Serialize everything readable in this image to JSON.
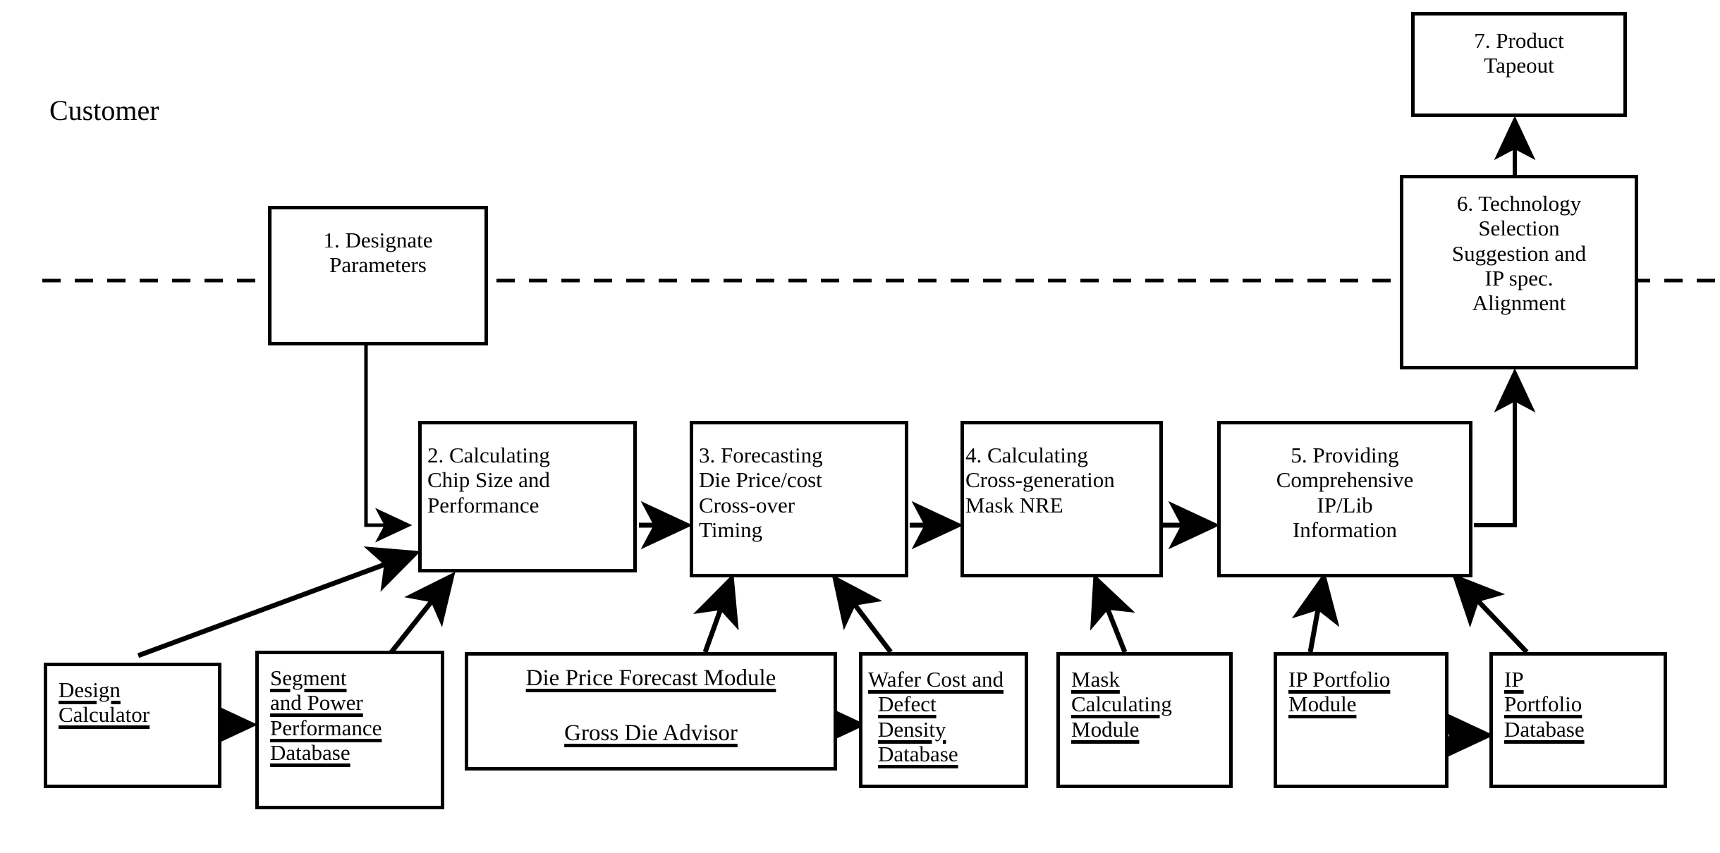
{
  "diagram": {
    "title_label": "Customer",
    "boundary": {
      "name": "customer-boundary-dashed-line"
    },
    "process_boxes": [
      {
        "id": "p1",
        "lines": [
          "1. Designate",
          "Parameters"
        ]
      },
      {
        "id": "p2",
        "lines": [
          "2. Calculating",
          "Chip Size and",
          "Performance"
        ]
      },
      {
        "id": "p3",
        "lines": [
          "3. Forecasting",
          "Die Price/cost",
          "Cross-over",
          "Timing"
        ]
      },
      {
        "id": "p4",
        "lines": [
          "4. Calculating",
          "Cross-generation",
          "Mask NRE"
        ]
      },
      {
        "id": "p5",
        "lines": [
          "5. Providing",
          "Comprehensive",
          "IP/Lib",
          "Information"
        ]
      },
      {
        "id": "p6",
        "lines": [
          "6. Technology",
          "Selection",
          "Suggestion and",
          "IP spec.",
          "Alignment"
        ]
      },
      {
        "id": "p7",
        "lines": [
          "7. Product",
          "Tapeout"
        ]
      }
    ],
    "data_boxes": [
      {
        "id": "d1",
        "lines": [
          "Design",
          "Calculator"
        ]
      },
      {
        "id": "d2",
        "lines": [
          "Segment",
          "and Power",
          "Performance",
          "Database"
        ]
      },
      {
        "id": "d3",
        "lines": [
          "Die Price Forecast  Module",
          "",
          "Gross Die Advisor"
        ]
      },
      {
        "id": "d4",
        "lines": [
          "Wafer Cost and",
          "Defect",
          "Density",
          "Database "
        ]
      },
      {
        "id": "d5",
        "lines": [
          "Mask",
          "Calculating",
          "Module"
        ]
      },
      {
        "id": "d6",
        "lines": [
          "IP Portfolio",
          "Module"
        ]
      },
      {
        "id": "d7",
        "lines": [
          "IP",
          "Portfolio ",
          "Database"
        ]
      }
    ],
    "colors": {
      "ink": "#000000",
      "paper": "#ffffff"
    }
  }
}
